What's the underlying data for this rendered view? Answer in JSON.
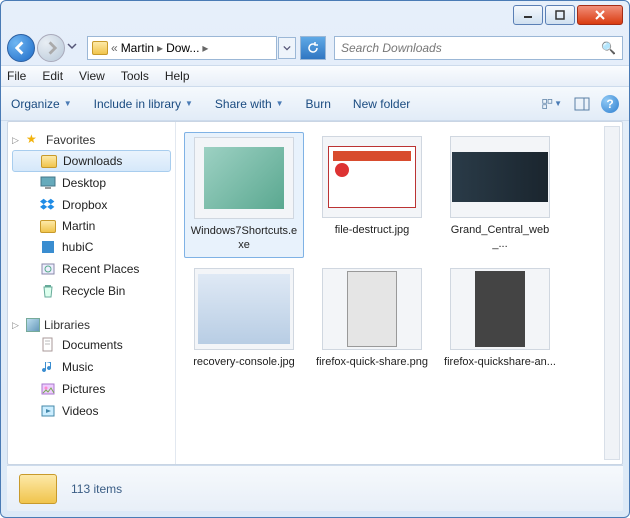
{
  "breadcrumb": {
    "root": "«",
    "part1": "Martin",
    "part2": "Dow...",
    "sep": "▸"
  },
  "search": {
    "placeholder": "Search Downloads",
    "icon": "🔍"
  },
  "menu": {
    "file": "File",
    "edit": "Edit",
    "view": "View",
    "tools": "Tools",
    "help": "Help"
  },
  "toolbar": {
    "organize": "Organize",
    "include": "Include in library",
    "share": "Share with",
    "burn": "Burn",
    "newfolder": "New folder"
  },
  "nav": {
    "favorites": "Favorites",
    "fav_items": [
      {
        "label": "Downloads",
        "icon": "folder",
        "selected": true
      },
      {
        "label": "Desktop",
        "icon": "desktop"
      },
      {
        "label": "Dropbox",
        "icon": "dropbox"
      },
      {
        "label": "Martin",
        "icon": "folder"
      },
      {
        "label": "hubiC",
        "icon": "hubic"
      },
      {
        "label": "Recent Places",
        "icon": "recent"
      },
      {
        "label": "Recycle Bin",
        "icon": "recycle"
      }
    ],
    "libraries": "Libraries",
    "lib_items": [
      {
        "label": "Documents",
        "icon": "doc"
      },
      {
        "label": "Music",
        "icon": "music"
      },
      {
        "label": "Pictures",
        "icon": "pic"
      },
      {
        "label": "Videos",
        "icon": "vid"
      }
    ]
  },
  "files": [
    {
      "label": "Windows7Shortcuts.exe",
      "thumb": "green",
      "selected": true
    },
    {
      "label": "file-destruct.jpg",
      "thumb": "red"
    },
    {
      "label": "Grand_Central_web_...",
      "thumb": "dark"
    },
    {
      "label": "recovery-console.jpg",
      "thumb": "blue"
    },
    {
      "label": "firefox-quick-share.png",
      "thumb": "phone"
    },
    {
      "label": "firefox-quickshare-an...",
      "thumb": "phone2"
    }
  ],
  "status": {
    "count": "113 items"
  }
}
